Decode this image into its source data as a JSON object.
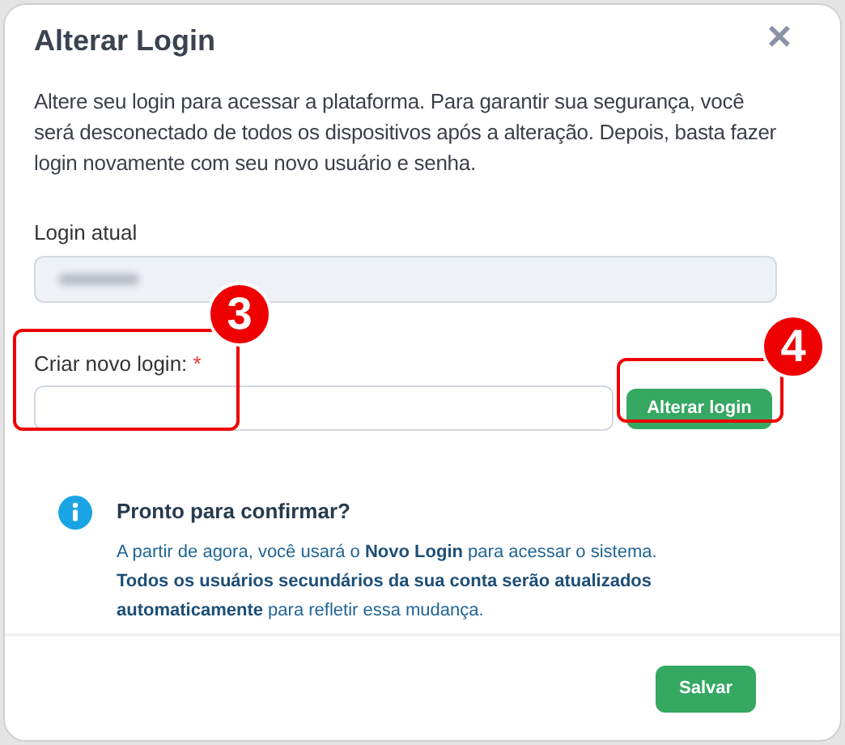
{
  "modal": {
    "title": "Alterar Login",
    "close": "×",
    "description": "Altere seu login para acessar a plataforma. Para garantir sua segurança, você será desconectado de todos os dispositivos após a alteração. Depois, basta fazer login novamente com seu novo usuário e senha.",
    "current_login": {
      "label": "Login atual",
      "redacted": true
    },
    "new_login": {
      "label": "Criar novo login:",
      "required": "*",
      "button": "Alterar login"
    },
    "info": {
      "title": "Pronto para confirmar?",
      "lines": [
        "A partir de agora, você usará o **Novo Login** para acessar o sistema.",
        "**Todos os usuários secundários da sua conta serão atualizados automaticamente** para refletir essa mudança."
      ]
    },
    "footer": {
      "button": "Salvar"
    }
  },
  "annotations": [
    {
      "number": "3"
    },
    {
      "number": "4"
    }
  ]
}
